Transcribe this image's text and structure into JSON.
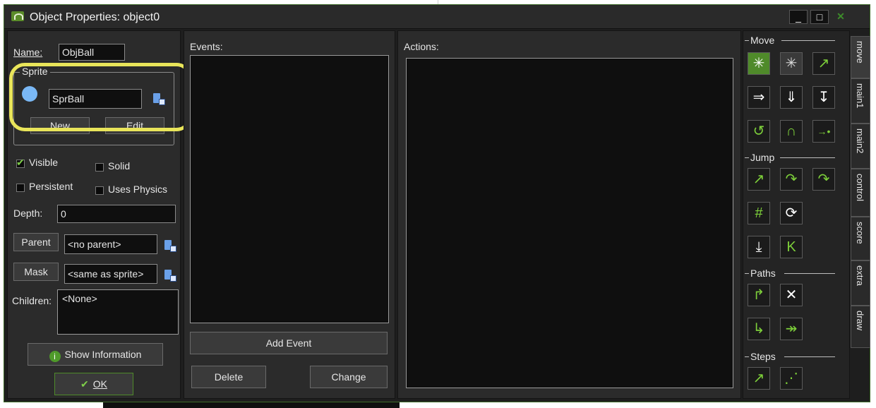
{
  "window": {
    "title": "Object Properties: object0"
  },
  "left": {
    "name_label": "Name:",
    "name_value": "ObjBall",
    "sprite_legend": "Sprite",
    "sprite_value": "SprBall",
    "new_label": "New",
    "edit_label": "Edit",
    "visible_label": "Visible",
    "solid_label": "Solid",
    "persistent_label": "Persistent",
    "physics_label": "Uses Physics",
    "depth_label": "Depth:",
    "depth_value": "0",
    "parent_label": "Parent",
    "parent_value": "<no parent>",
    "mask_label": "Mask",
    "mask_value": "<same as sprite>",
    "children_label": "Children:",
    "children_value": "<None>",
    "show_info_label": "Show Information",
    "ok_label": "OK"
  },
  "events": {
    "label": "Events:",
    "add_label": "Add Event",
    "delete_label": "Delete",
    "change_label": "Change"
  },
  "actions": {
    "label": "Actions:"
  },
  "toolbox": {
    "groups": {
      "move": "Move",
      "jump": "Jump",
      "paths": "Paths",
      "steps": "Steps"
    }
  },
  "tabs": [
    "move",
    "main1",
    "main2",
    "control",
    "score",
    "extra",
    "draw"
  ],
  "colors": {
    "accent": "#4f8a2a",
    "highlight": "#e9e55a",
    "sprite": "#7ab8f5"
  }
}
